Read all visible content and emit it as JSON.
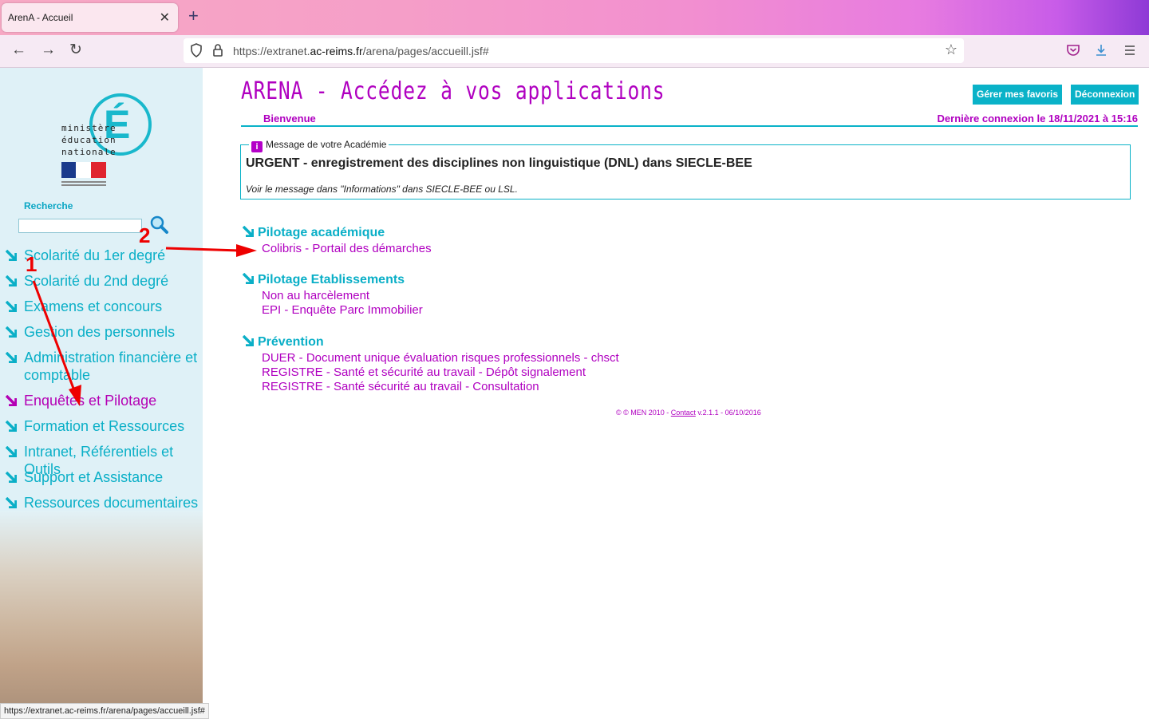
{
  "browser": {
    "tab_title": "ArenA - Accueil",
    "url_prefix": "https://extranet.",
    "url_domain": "ac-reims.fr",
    "url_path": "/arena/pages/accueill.jsf#",
    "status_url": "https://extranet.ac-reims.fr/arena/pages/accueill.jsf#"
  },
  "sidebar": {
    "logo_lines": [
      "ministère",
      "éducation",
      "nationale"
    ],
    "search_label": "Recherche",
    "items": [
      {
        "label": "Scolarité du 1er degré"
      },
      {
        "label": "Scolarité du 2nd degré"
      },
      {
        "label": "Examens et concours"
      },
      {
        "label": "Gestion des personnels"
      },
      {
        "label": "Administration financière et comptable"
      },
      {
        "label": "Enquêtes et Pilotage",
        "active": true
      },
      {
        "label": "Formation et Ressources"
      },
      {
        "label": "Intranet, Référentiels et Outils"
      },
      {
        "label": "Support et Assistance"
      },
      {
        "label": "Ressources documentaires"
      }
    ]
  },
  "header": {
    "title": "ARENA - Accédez à vos applications",
    "favorites_button": "Gérer mes favoris",
    "logout_button": "Déconnexion",
    "welcome": "Bienvenue",
    "last_connection": "Dernière connexion le 18/11/2021 à  15:16"
  },
  "message": {
    "legend": "Message de votre Académie",
    "title": "URGENT - enregistrement des disciplines non linguistique (DNL) dans SIECLE-BEE",
    "body": "Voir le message dans \"Informations\" dans SIECLE-BEE ou LSL."
  },
  "sections": [
    {
      "title": "Pilotage académique",
      "links": [
        "Colibris - Portail des démarches"
      ]
    },
    {
      "title": "Pilotage Etablissements",
      "links": [
        "Non au harcèlement",
        "EPI - Enquête Parc Immobilier"
      ]
    },
    {
      "title": "Prévention",
      "links": [
        "DUER - Document unique évaluation risques professionnels - chsct",
        "REGISTRE - Santé et sécurité au travail - Dépôt signalement",
        "REGISTRE - Santé sécurité au travail - Consultation"
      ]
    }
  ],
  "footer": {
    "prefix": "© © MEN 2010 - ",
    "contact": "Contact",
    "version": " v.2.1.1 - 06/10/2016"
  },
  "annotations": {
    "one": "1",
    "two": "2"
  },
  "colors": {
    "accent": "#0ab2c8",
    "brand": "#b000c0",
    "annotation": "#ee0000"
  }
}
